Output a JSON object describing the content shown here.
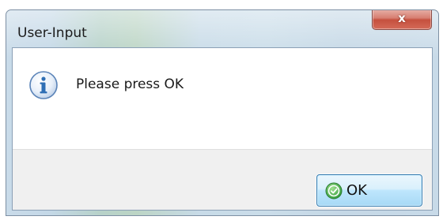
{
  "window": {
    "title": "User-Input"
  },
  "message": {
    "text": "Please press OK",
    "icon": "info-icon"
  },
  "buttons": {
    "ok_label": "OK",
    "ok_icon": "check-circle-icon",
    "close_icon": "close-icon",
    "close_glyph": "x"
  },
  "colors": {
    "close_button": "#d46a58",
    "ok_button_border": "#3c7fb1",
    "ok_icon": "#3aa543",
    "info_icon": "#2f6fb5"
  }
}
